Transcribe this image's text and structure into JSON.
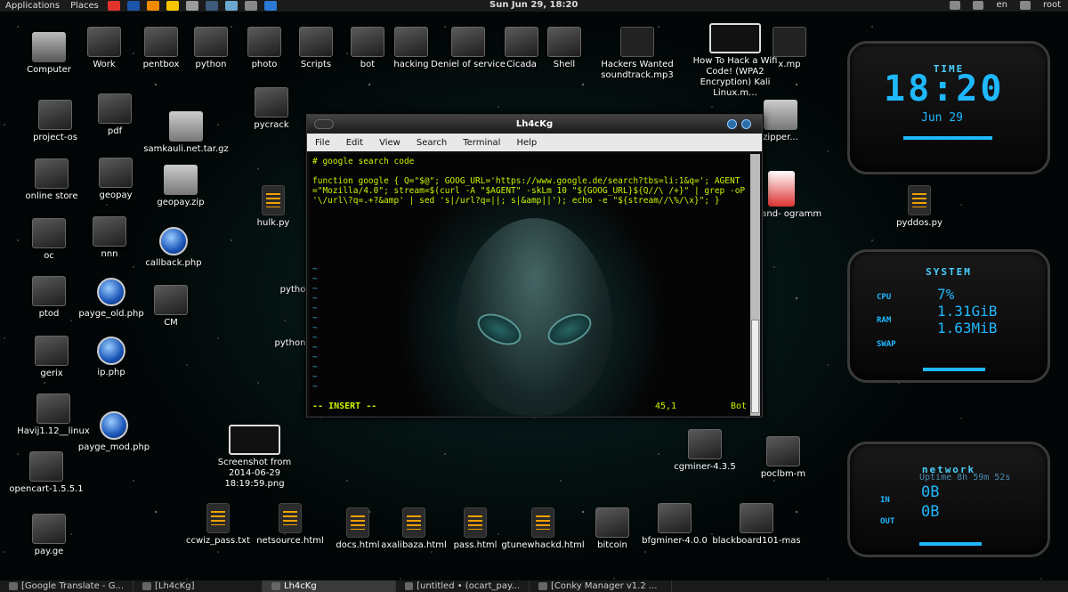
{
  "top_panel": {
    "applications": "Applications",
    "places": "Places",
    "clock": "Sun Jun 29, 18:20",
    "lang": "en",
    "user": "root",
    "launchers": [
      {
        "name": "chrome-icon",
        "color": "#e2342c"
      },
      {
        "name": "firefox-icon",
        "color": "#1b54a8"
      },
      {
        "name": "pdf-reader-icon",
        "color": "#f08a00"
      },
      {
        "name": "python-icon",
        "color": "#f7c600"
      },
      {
        "name": "text-editor-icon",
        "color": "#9b9b9b"
      },
      {
        "name": "terminal-icon",
        "color": "#3c5a7a"
      },
      {
        "name": "image-viewer-icon",
        "color": "#6aa8d0"
      },
      {
        "name": "screenshot-icon",
        "color": "#888888"
      },
      {
        "name": "web-browser-icon",
        "color": "#2c7ad6"
      }
    ]
  },
  "desktop": {
    "icons": [
      {
        "label": "Computer",
        "kind": "drive",
        "name": "computer-icon"
      },
      {
        "label": "Work",
        "kind": "folder",
        "name": "folder-icon"
      },
      {
        "label": "pentbox",
        "kind": "folder",
        "name": "folder-icon"
      },
      {
        "label": "python",
        "kind": "folder",
        "name": "folder-icon"
      },
      {
        "label": "photo",
        "kind": "folder",
        "name": "folder-icon"
      },
      {
        "label": "Scripts",
        "kind": "folder",
        "name": "folder-icon"
      },
      {
        "label": "bot",
        "kind": "folder",
        "name": "folder-icon"
      },
      {
        "label": "hacking",
        "kind": "folder",
        "name": "folder-icon"
      },
      {
        "label": "Deniel of service",
        "kind": "folder",
        "name": "folder-icon"
      },
      {
        "label": "Cicada",
        "kind": "folder",
        "name": "folder-icon"
      },
      {
        "label": "Shell",
        "kind": "folder",
        "name": "folder-icon"
      },
      {
        "label": "Hackers Wanted soundtrack.mp3",
        "kind": "audio",
        "name": "audio-file-icon"
      },
      {
        "label": "How To Hack a Wifi Code! (WPA2 Encryption) Kali Linux.m...",
        "kind": "thumb",
        "name": "video-thumbnail-icon"
      },
      {
        "label": "x.mp",
        "kind": "audio",
        "name": "audio-file-icon"
      },
      {
        "label": "project-os",
        "kind": "folder",
        "name": "folder-icon"
      },
      {
        "label": "pdf",
        "kind": "folder",
        "name": "folder-icon"
      },
      {
        "label": "samkauli.net.tar.gz",
        "kind": "archive",
        "name": "archive-icon"
      },
      {
        "label": "pycrack",
        "kind": "folder",
        "name": "folder-icon"
      },
      {
        "label": "zipper...",
        "kind": "archive",
        "name": "archive-icon"
      },
      {
        "label": "online store",
        "kind": "folder",
        "name": "folder-icon"
      },
      {
        "label": "geopay",
        "kind": "folder",
        "name": "folder-icon"
      },
      {
        "label": "geopay.zip",
        "kind": "archive",
        "name": "archive-icon"
      },
      {
        "label": "hulk.py",
        "kind": "script",
        "name": "script-file-icon"
      },
      {
        "label": "non-and- ogramm",
        "kind": "book",
        "name": "book-cover-icon"
      },
      {
        "label": "pyddos.py",
        "kind": "script",
        "name": "script-file-icon"
      },
      {
        "label": "oc",
        "kind": "folder",
        "name": "folder-icon"
      },
      {
        "label": "nnn",
        "kind": "folder",
        "name": "folder-icon"
      },
      {
        "label": "callback.php",
        "kind": "php",
        "name": "php-file-icon"
      },
      {
        "label": "pytho",
        "kind": "none",
        "name": "desktop-label"
      },
      {
        "label": "ptod",
        "kind": "folder",
        "name": "folder-icon"
      },
      {
        "label": "payge_old.php",
        "kind": "php",
        "name": "php-file-icon"
      },
      {
        "label": "CM",
        "kind": "folder",
        "name": "folder-icon"
      },
      {
        "label": "python",
        "kind": "none",
        "name": "desktop-label"
      },
      {
        "label": "gerix",
        "kind": "folder",
        "name": "folder-icon"
      },
      {
        "label": "ip.php",
        "kind": "php",
        "name": "php-file-icon"
      },
      {
        "label": "Havij1.12__linux",
        "kind": "folder",
        "name": "folder-icon"
      },
      {
        "label": "payge_mod.php",
        "kind": "php",
        "name": "php-file-icon"
      },
      {
        "label": "Screenshot from 2014-06-29 18:19:59.png",
        "kind": "thumb",
        "name": "image-file-icon"
      },
      {
        "label": "cgminer-4.3.5",
        "kind": "folder",
        "name": "folder-icon"
      },
      {
        "label": "poclbm-m",
        "kind": "folder",
        "name": "folder-icon"
      },
      {
        "label": "opencart-1.5.5.1",
        "kind": "folder",
        "name": "folder-icon"
      },
      {
        "label": "pay.ge",
        "kind": "folder",
        "name": "folder-icon"
      },
      {
        "label": "ccwiz_pass.txt",
        "kind": "script",
        "name": "text-file-icon"
      },
      {
        "label": "netsource.html",
        "kind": "script",
        "name": "html-file-icon"
      },
      {
        "label": "docs.html",
        "kind": "script",
        "name": "html-file-icon"
      },
      {
        "label": "axalibaza.html",
        "kind": "script",
        "name": "html-file-icon"
      },
      {
        "label": "pass.html",
        "kind": "script",
        "name": "html-file-icon"
      },
      {
        "label": "gtunewhackd.html",
        "kind": "script",
        "name": "html-file-icon"
      },
      {
        "label": "bitcoin",
        "kind": "folder",
        "name": "folder-icon"
      },
      {
        "label": "bfgminer-4.0.0",
        "kind": "folder",
        "name": "folder-icon"
      },
      {
        "label": "blackboard101-mas",
        "kind": "folder",
        "name": "folder-icon"
      }
    ]
  },
  "terminal": {
    "title": "Lh4cKg",
    "menu": [
      "File",
      "Edit",
      "View",
      "Search",
      "Terminal",
      "Help"
    ],
    "comment": "# google search code",
    "code": "function google { Q=\"$@\"; GOOG_URL='https://www.google.de/search?tbs=li:1&q='; AGENT=\"Mozilla/4.0\"; stream=$(curl -A \"$AGENT\" -skLm 10 \"${GOOG_URL}${Q//\\ /+}\" | grep -oP '\\/url\\?q=.+?&amp' | sed 's|/url?q=||; s|&amp||'); echo -e \"${stream//\\%/\\x}\"; }",
    "mode": "-- INSERT --",
    "position": "45,1",
    "scroll": "Bot"
  },
  "conky": {
    "time": {
      "heading": "TIME",
      "clock": "18:20",
      "date": "Jun 29"
    },
    "system": {
      "heading": "SYSTEM",
      "cpu_label": "CPU",
      "cpu": "7%",
      "ram_label": "RAM",
      "ram": "1.31GiB",
      "swap_label": "SWAP",
      "swap": "1.63MiB"
    },
    "network": {
      "heading": "network",
      "uptime": "Uptime 8h 59m 52s",
      "in_label": "IN",
      "in": "0B",
      "out_label": "OUT",
      "out": "0B"
    }
  },
  "taskbar": {
    "tasks": [
      {
        "label": "[Google Translate - G...",
        "active": false
      },
      {
        "label": "[Lh4cKg]",
        "active": false
      },
      {
        "label": "Lh4cKg",
        "active": true
      },
      {
        "label": "[untitled • (ocart_pay...",
        "active": false
      },
      {
        "label": "[Conky Manager v1.2 ...",
        "active": false
      }
    ]
  }
}
